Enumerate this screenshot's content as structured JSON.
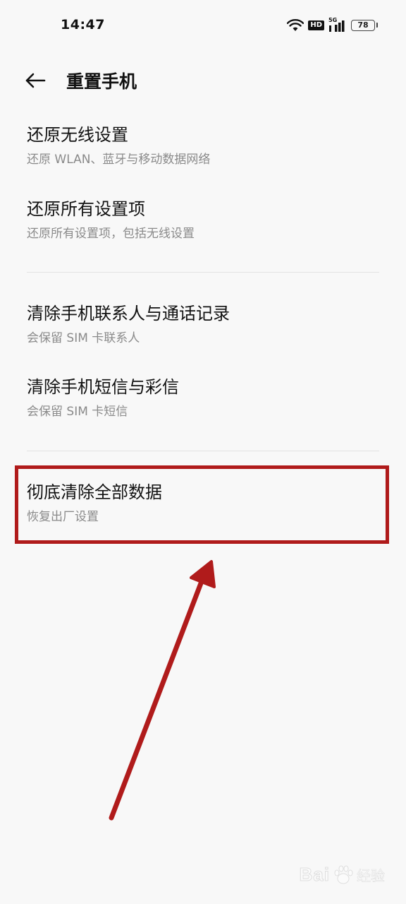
{
  "status_bar": {
    "time": "14:47",
    "hd": "HD",
    "network": "5G",
    "battery": "78"
  },
  "header": {
    "title": "重置手机"
  },
  "reset_items": [
    {
      "title": "还原无线设置",
      "description": "还原 WLAN、蓝牙与移动数据网络"
    },
    {
      "title": "还原所有设置项",
      "description": "还原所有设置项，包括无线设置"
    },
    {
      "title": "清除手机联系人与通话记录",
      "description": "会保留 SIM 卡联系人"
    },
    {
      "title": "清除手机短信与彩信",
      "description": "会保留 SIM 卡短信"
    },
    {
      "title": "彻底清除全部数据",
      "description": "恢复出厂设置"
    }
  ],
  "annotation": {
    "color": "#b01b1b"
  },
  "watermark": {
    "brand": "Bai",
    "sub": "经验"
  }
}
